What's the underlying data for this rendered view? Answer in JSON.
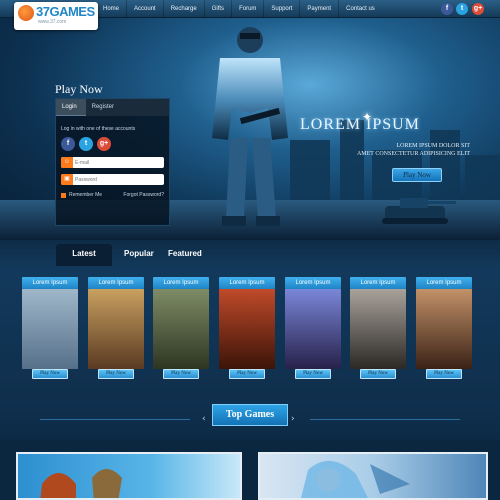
{
  "logo": {
    "text": "37GAMES",
    "sub": "www.37.com"
  },
  "nav": {
    "links": [
      "Home",
      "Account",
      "Recharge",
      "Gifts",
      "Forum",
      "Support",
      "Payment",
      "Contact us"
    ]
  },
  "social": {
    "facebook": "f",
    "twitter": "t",
    "googleplus": "g+"
  },
  "login": {
    "title": "Play Now",
    "tab_login": "Login",
    "tab_register": "Register",
    "subtitle": "Log in with one of these accounts",
    "email_placeholder": "E-mail",
    "password_placeholder": "Password",
    "remember": "Remember Me",
    "forgot": "Forgot Password?"
  },
  "hero": {
    "title": "LOREM IPSUM",
    "line1": "LOREM IPSUM DOLOR SIT",
    "line2": "AMET CONSECTETUR ADIPISICING ELIT",
    "button": "Play Now"
  },
  "game_tabs": [
    "Latest",
    "Popular",
    "Featured"
  ],
  "cards": [
    {
      "label": "Lorem Ipsum",
      "button": "Play Now",
      "colors": [
        "#9fb7c9",
        "#56708a"
      ]
    },
    {
      "label": "Lorem Ipsum",
      "button": "Play Now",
      "colors": [
        "#c8a060",
        "#5a3a22"
      ]
    },
    {
      "label": "Lorem Ipsum",
      "button": "Play Now",
      "colors": [
        "#7e8c66",
        "#2e3522"
      ]
    },
    {
      "label": "Lorem Ipsum",
      "button": "Play Now",
      "colors": [
        "#c04a2a",
        "#3b1408"
      ]
    },
    {
      "label": "Lorem Ipsum",
      "button": "Play Now",
      "colors": [
        "#7a86d8",
        "#27214a"
      ]
    },
    {
      "label": "Lorem Ipsum",
      "button": "Play Now",
      "colors": [
        "#a8a29a",
        "#2b2825"
      ]
    },
    {
      "label": "Lorem Ipsum",
      "button": "Play Now",
      "colors": [
        "#c29168",
        "#3a2216"
      ]
    }
  ],
  "top_games": {
    "title": "Top Games",
    "prev": "‹",
    "next": "›"
  }
}
